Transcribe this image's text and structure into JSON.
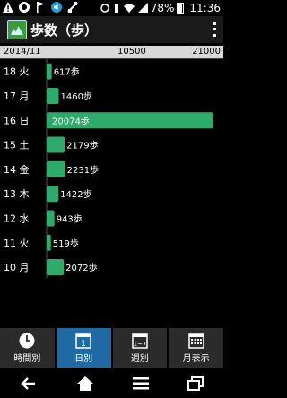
{
  "status_bar": {
    "battery": "78%",
    "time": "11:36"
  },
  "app": {
    "title": "歩数（歩）",
    "icon": "app-logo-icon"
  },
  "axis": {
    "month": "2014/11",
    "mid_tick": "10500",
    "max_tick": "21000"
  },
  "chart_data": {
    "type": "bar",
    "orientation": "horizontal",
    "xlim": [
      0,
      21000
    ],
    "categories": [
      "18 火",
      "17 月",
      "16 日",
      "15 土",
      "14 金",
      "13 木",
      "12 水",
      "11 火",
      "10 月"
    ],
    "values": [
      617,
      1460,
      20074,
      2179,
      2231,
      1422,
      943,
      519,
      2072
    ],
    "value_labels": [
      "617歩",
      "1460歩",
      "20074歩",
      "2179歩",
      "2231歩",
      "1422歩",
      "943歩",
      "519歩",
      "2072歩"
    ],
    "bar_color": "#2eaa6b"
  },
  "tabs": [
    {
      "label": "時間別",
      "icon": "clock-icon",
      "active": false
    },
    {
      "label": "日別",
      "icon": "calendar-day-icon",
      "active": true
    },
    {
      "label": "週別",
      "icon": "calendar-week-icon",
      "active": false
    },
    {
      "label": "月表示",
      "icon": "calendar-month-icon",
      "active": false
    }
  ],
  "colors": {
    "accent": "#1f6aa5",
    "bar": "#2eaa6b"
  }
}
